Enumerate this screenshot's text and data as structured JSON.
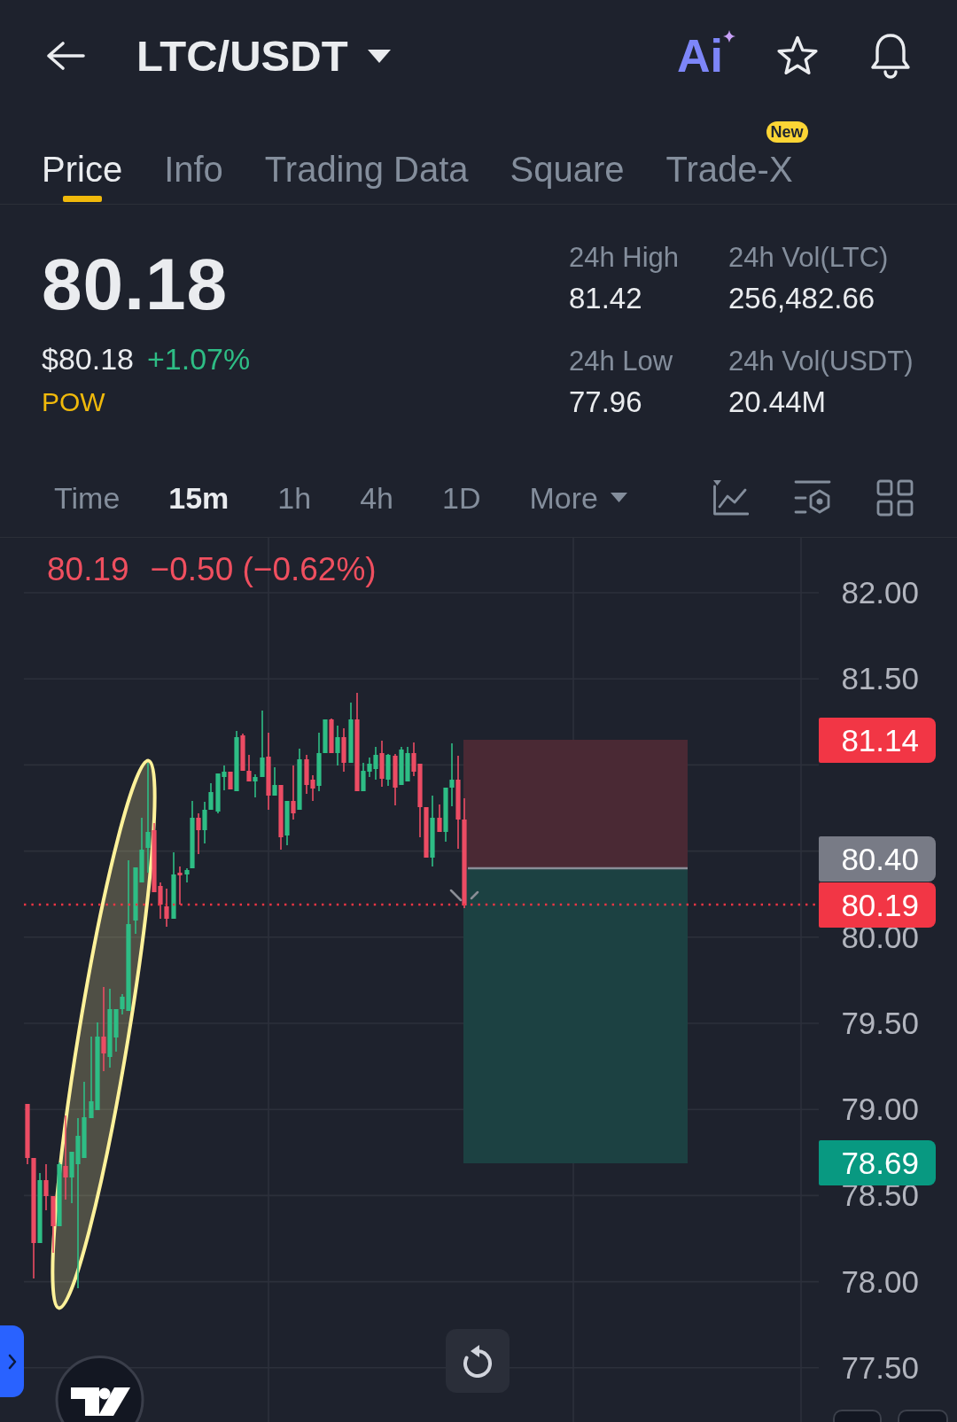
{
  "header": {
    "title": "LTC/USDT",
    "ai_label": "Ai"
  },
  "tabs": [
    {
      "label": "Price",
      "selected": true
    },
    {
      "label": "Info",
      "selected": false
    },
    {
      "label": "Trading Data",
      "selected": false
    },
    {
      "label": "Square",
      "selected": false
    },
    {
      "label": "Trade-X",
      "selected": false,
      "badge": "New"
    }
  ],
  "quote": {
    "last": "80.18",
    "fiat": "$80.18",
    "change": "+1.07%",
    "tag": "POW"
  },
  "stats": [
    {
      "label": "24h High",
      "value": "81.42"
    },
    {
      "label": "24h Vol(LTC)",
      "value": "256,482.66"
    },
    {
      "label": "24h Low",
      "value": "77.96"
    },
    {
      "label": "24h Vol(USDT)",
      "value": "20.44M"
    }
  ],
  "intervals": [
    {
      "label": "Time",
      "kind": "option",
      "selected": false
    },
    {
      "label": "15m",
      "kind": "option",
      "selected": true
    },
    {
      "label": "1h",
      "kind": "option",
      "selected": false
    },
    {
      "label": "4h",
      "kind": "option",
      "selected": false
    },
    {
      "label": "1D",
      "kind": "option",
      "selected": false
    },
    {
      "label": "More",
      "kind": "menu",
      "selected": false
    }
  ],
  "chart": {
    "legend": {
      "price": "80.19",
      "change": "−0.50 (−0.62%)"
    },
    "y_axis_labels": [
      "82.00",
      "81.50",
      "80.00",
      "79.50",
      "79.00",
      "78.50",
      "78.00",
      "77.50"
    ],
    "price_tags": [
      {
        "value": "81.14",
        "color": "#f23645"
      },
      {
        "value": "80.40",
        "color": "#787b86"
      },
      {
        "value": "80.19",
        "color": "#f23645"
      },
      {
        "value": "78.69",
        "color": "#089981"
      }
    ]
  }
}
